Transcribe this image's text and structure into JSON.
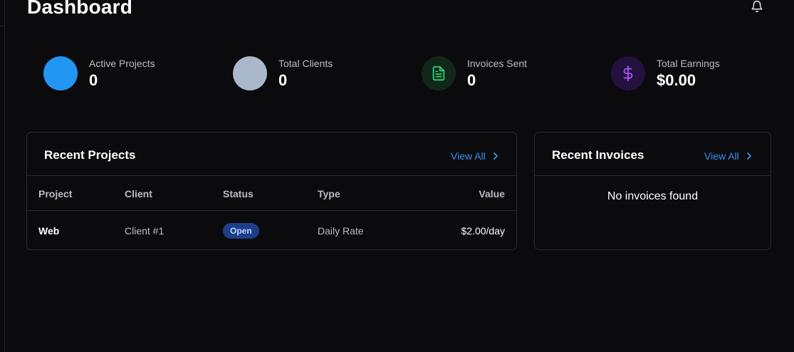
{
  "page": {
    "title": "Dashboard"
  },
  "stats": [
    {
      "label": "Active Projects",
      "value": "0",
      "color": "#2196f3"
    },
    {
      "label": "Total Clients",
      "value": "0",
      "color": "#aab8cc"
    },
    {
      "label": "Invoices Sent",
      "value": "0",
      "color": "#10281a",
      "icon": "file-text-icon"
    },
    {
      "label": "Total Earnings",
      "value": "$0.00",
      "color": "#24113f",
      "icon": "dollar-icon"
    }
  ],
  "recent_projects": {
    "title": "Recent Projects",
    "view_all": "View All",
    "columns": [
      "Project",
      "Client",
      "Status",
      "Type",
      "Value"
    ],
    "rows": [
      {
        "project": "Web",
        "client": "Client #1",
        "status": "Open",
        "type": "Daily Rate",
        "value": "$2.00/day"
      }
    ]
  },
  "recent_invoices": {
    "title": "Recent Invoices",
    "view_all": "View All",
    "empty": "No invoices found"
  },
  "colors": {
    "accent": "#3b8ff0",
    "background": "#0b0b0d",
    "border": "#2a2a30",
    "badge_bg": "#1d3f8a"
  }
}
